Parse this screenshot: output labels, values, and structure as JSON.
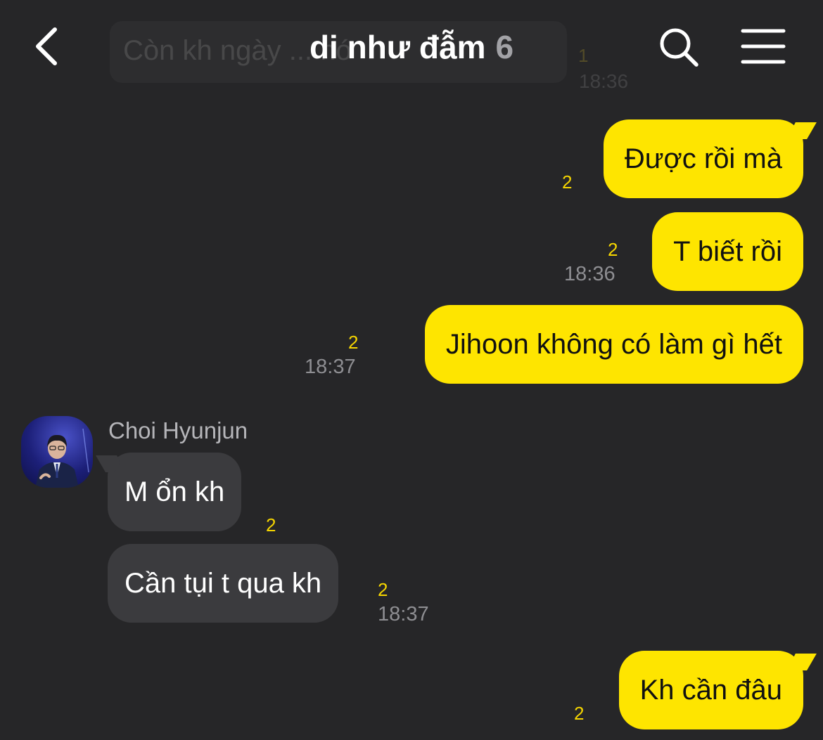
{
  "header": {
    "title": "di như đẫm",
    "member_count": "6",
    "back_icon": "chevron-left-icon",
    "search_icon": "search-icon",
    "menu_icon": "hamburger-menu-icon"
  },
  "ghost_message": {
    "text": "Còn kh ngày ... nó",
    "unread": "1",
    "time": "18:36"
  },
  "messages_out_1": [
    {
      "text": "Được rồi mà",
      "unread": "2",
      "time": ""
    },
    {
      "text": "T biết rồi",
      "unread": "2",
      "time": "18:36"
    },
    {
      "text": "Jihoon không có làm gì hết",
      "unread": "2",
      "time": "18:37"
    }
  ],
  "incoming": {
    "sender": "Choi Hyunjun",
    "avatar_icon": "profile-photo",
    "messages": [
      {
        "text": "M ổn kh",
        "unread": "2",
        "time": ""
      },
      {
        "text": "Cần tụi t qua kh",
        "unread": "2",
        "time": "18:37"
      }
    ]
  },
  "messages_out_2": [
    {
      "text": "Kh cần đâu",
      "unread": "2",
      "time": ""
    }
  ],
  "colors": {
    "background": "#262628",
    "outgoing_bubble": "#FEE500",
    "incoming_bubble": "#3b3b3e",
    "unread_count": "#F5D500",
    "timestamp": "#8e8e92"
  }
}
